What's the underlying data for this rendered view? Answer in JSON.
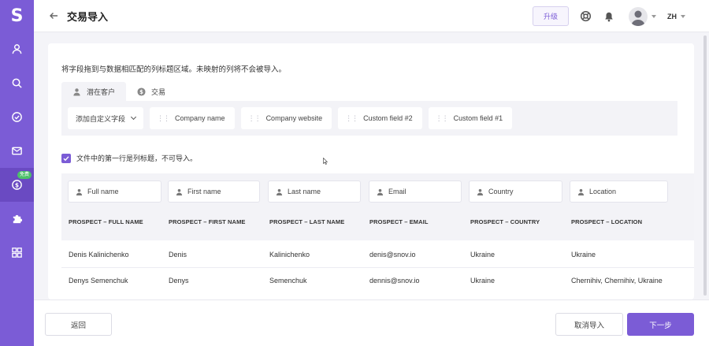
{
  "app": {
    "logo": "S"
  },
  "sidebar": {
    "items": [
      {
        "icon": "user-icon"
      },
      {
        "icon": "search-icon"
      },
      {
        "icon": "check-circle-icon"
      },
      {
        "icon": "mail-icon"
      },
      {
        "icon": "dollar-icon",
        "badge": "免费",
        "active": true
      },
      {
        "icon": "puzzle-icon"
      },
      {
        "icon": "grid-icon"
      }
    ]
  },
  "header": {
    "title": "交易导入",
    "upgrade_label": "升级",
    "lang": "ZH"
  },
  "main": {
    "instructions": "将字段拖到与数据相匹配的列标题区域。未映射的列将不会被导入。",
    "tabs": [
      {
        "label": "潜在客户",
        "icon": "person-icon",
        "active": true
      },
      {
        "label": "交易",
        "icon": "dollar-icon",
        "active": false
      }
    ],
    "fields": {
      "add_custom": "添加自定义字段",
      "chips": [
        "Company name",
        "Company website",
        "Custom field #2",
        "Custom field #1"
      ]
    },
    "header_row_checkbox": {
      "checked": true,
      "label": "文件中的第一行是列标题，不可导入。"
    },
    "table": {
      "mapped_fields": [
        "Full name",
        "First name",
        "Last name",
        "Email",
        "Country",
        "Location"
      ],
      "columns": [
        "PROSPECT – FULL NAME",
        "PROSPECT – FIRST NAME",
        "PROSPECT – LAST NAME",
        "PROSPECT – EMAIL",
        "PROSPECT – COUNTRY",
        "PROSPECT – LOCATION"
      ],
      "rows": [
        [
          "Denis Kalinichenko",
          "Denis",
          "Kalinichenko",
          "denis@snov.io",
          "Ukraine",
          "Ukraine"
        ],
        [
          "Denys Semenchuk",
          "Denys",
          "Semenchuk",
          "dennis@snov.io",
          "Ukraine",
          "Chernihiv, Chernihiv, Ukraine"
        ]
      ]
    }
  },
  "footer": {
    "back_label": "返回",
    "cancel_label": "取消导入",
    "next_label": "下一步"
  },
  "colors": {
    "accent": "#7b5cd6",
    "badge": "#4cc06a"
  }
}
